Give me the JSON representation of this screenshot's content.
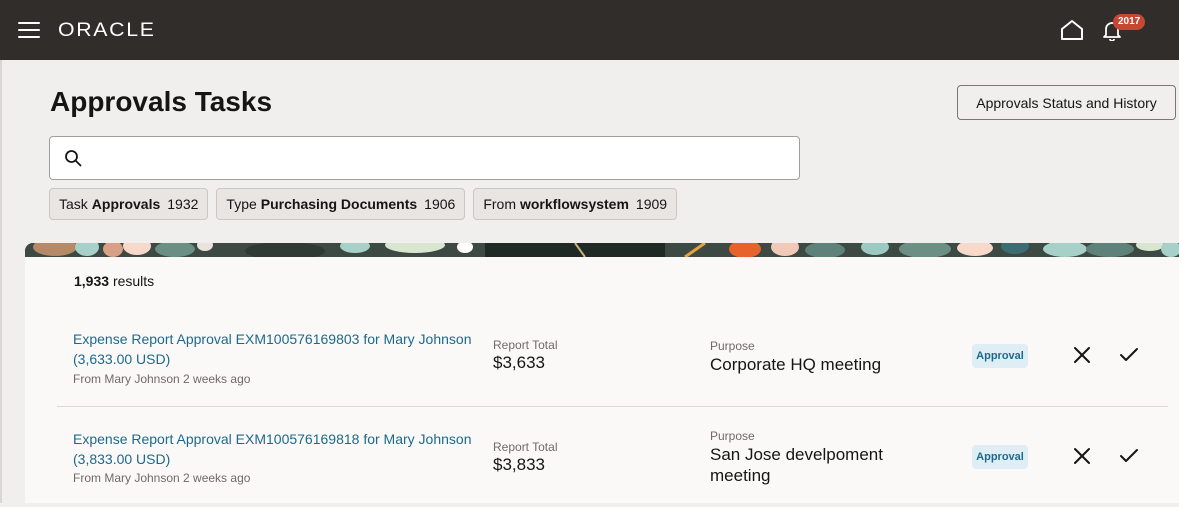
{
  "header": {
    "brand": "ORACLE",
    "notification_count": "2017",
    "icons": [
      "menu-icon",
      "home-icon",
      "bell-icon"
    ]
  },
  "page": {
    "title": "Approvals Tasks",
    "status_button": "Approvals Status and History",
    "search": {
      "value": "",
      "placeholder": ""
    }
  },
  "filters": [
    {
      "key": "Task",
      "value": "Approvals",
      "count": "1932"
    },
    {
      "key": "Type",
      "value": "Purchasing Documents",
      "count": "1906"
    },
    {
      "key": "From",
      "value": "workflowsystem",
      "count": "1909"
    }
  ],
  "results": {
    "count": "1,933",
    "label": "results"
  },
  "tasks": [
    {
      "title": "Expense Report Approval EXM100576169803 for Mary Johnson (3,633.00 USD)",
      "from": "From Mary Johnson 2 weeks ago",
      "total_label": "Report Total",
      "total_value": "$3,633",
      "purpose_label": "Purpose",
      "purpose_value": "Corporate HQ meeting",
      "tag": "Approval"
    },
    {
      "title": "Expense Report Approval EXM100576169818 for Mary Johnson (3,833.00 USD)",
      "from": "From Mary Johnson 2 weeks ago",
      "total_label": "Report Total",
      "total_value": "$3,833",
      "purpose_label": "Purpose",
      "purpose_value": "San Jose develpoment meeting",
      "tag": "Approval"
    }
  ],
  "colors": {
    "topbar": "#312d2a",
    "link": "#1c6a8b",
    "badge": "#c74634",
    "page_bg": "#f1efed"
  }
}
